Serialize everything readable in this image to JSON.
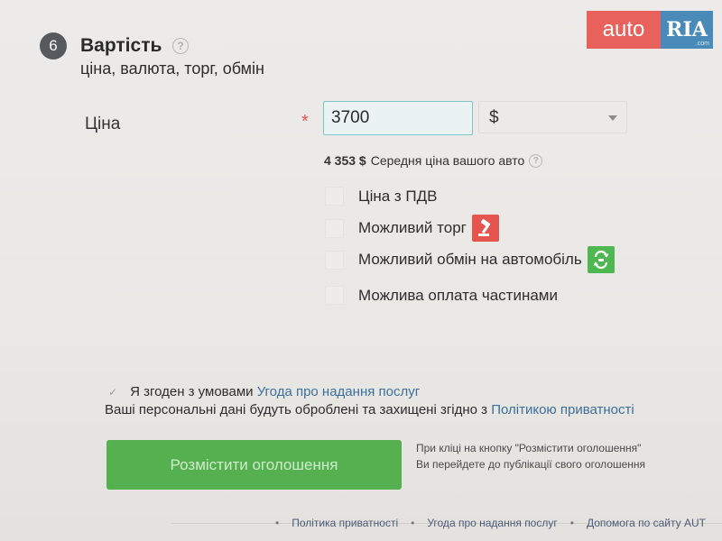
{
  "logo": {
    "auto": "auto",
    "ria": "RIA",
    "com": ".com"
  },
  "section": {
    "step": "6",
    "title": "Вартість",
    "help_icon": "?",
    "subtitle": "ціна, валюта, торг, обмін"
  },
  "price": {
    "label": "Ціна",
    "required_mark": "*",
    "value": "3700",
    "currency": "$"
  },
  "average": {
    "value": "4 353 $",
    "label": "Середня ціна вашого авто",
    "help_icon": "?"
  },
  "options": [
    {
      "label": "Ціна з ПДВ",
      "checked": false
    },
    {
      "label": "Можливий торг",
      "checked": false,
      "badge_icon": "gavel-icon",
      "badge_color": "#e5554e"
    },
    {
      "label": "Можливий обмін на автомобіль",
      "checked": false,
      "badge_icon": "exchange-icon",
      "badge_color": "#4cb84f"
    },
    {
      "label": "Можлива оплата частинами",
      "checked": false
    }
  ],
  "agreement": {
    "text": "Я згоден з умовами",
    "link": "Угода про надання послуг",
    "checked": true
  },
  "privacy": {
    "text": "Ваші персональні дані будуть оброблені та захищені згідно з",
    "link": "Політикою приватності"
  },
  "submit": {
    "label": "Розмістити оголошення",
    "note_line1": "При кліці на кнопку \"Розмістити оголошення\"",
    "note_line2": "Ви перейдете до публікації свого оголошення"
  },
  "footer": {
    "links": [
      "Політика приватності",
      "Угода про надання послуг",
      "Допомога по сайту AUT"
    ]
  },
  "colors": {
    "accent_green": "#55b04f",
    "link_blue": "#3c6f9c",
    "required_red": "#e25751",
    "logo_red": "#e8615a",
    "logo_blue": "#4a8ab8"
  }
}
